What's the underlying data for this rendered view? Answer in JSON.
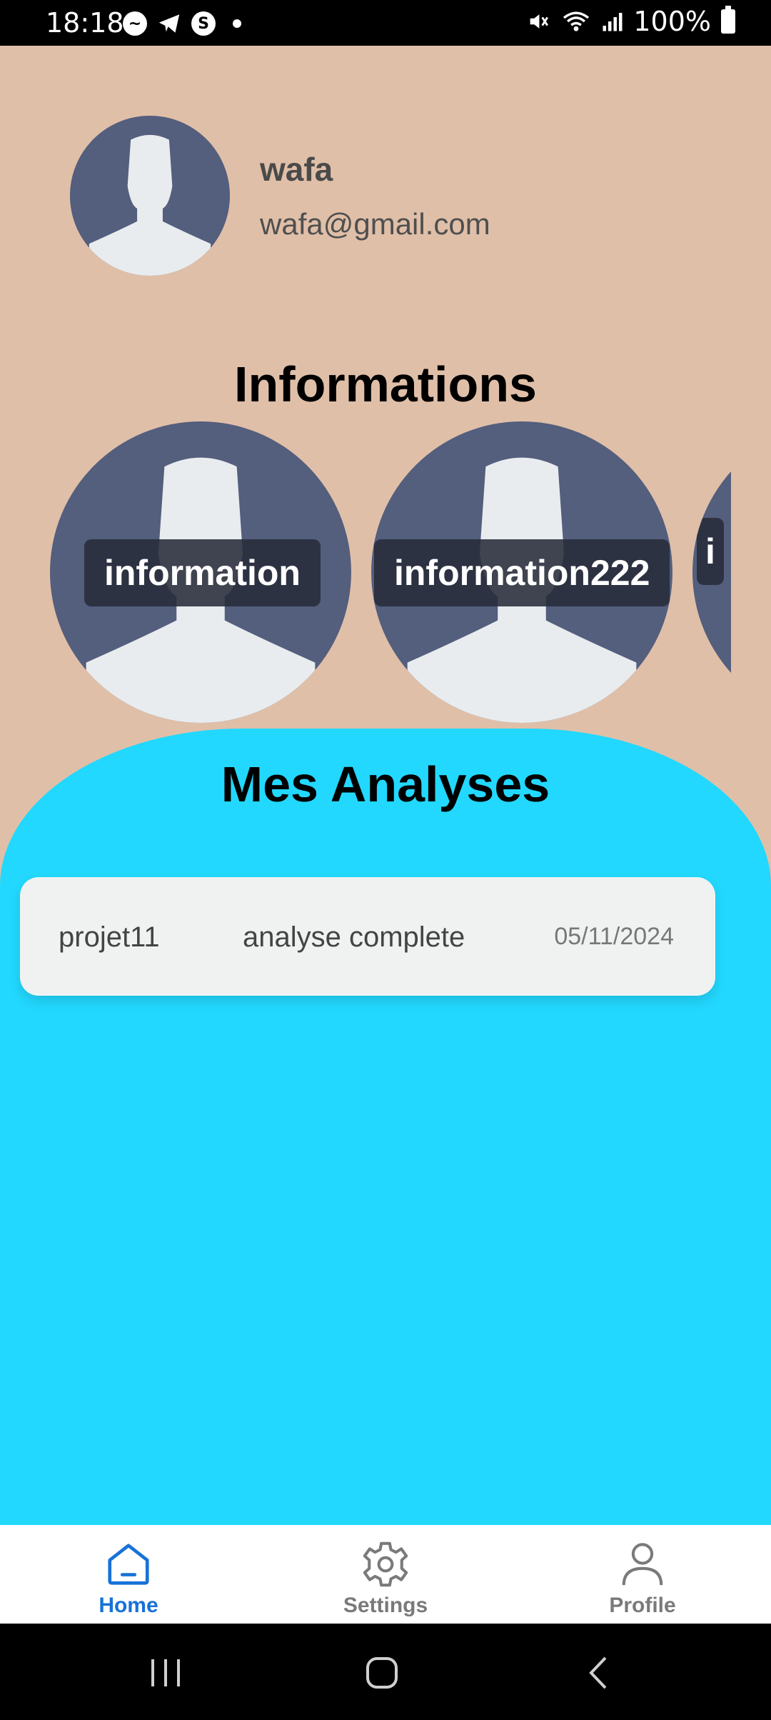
{
  "status_bar": {
    "time": "18:18",
    "battery": "100%",
    "icons": [
      "messenger-icon",
      "telegram-icon",
      "skype-icon",
      "dot-icon",
      "mute-icon",
      "wifi-icon",
      "signal-icon",
      "battery-icon"
    ]
  },
  "profile": {
    "name": "wafa",
    "email": "wafa@gmail.com"
  },
  "informations": {
    "title": "Informations",
    "items": [
      {
        "label": "information"
      },
      {
        "label": "information222"
      },
      {
        "label": "i"
      }
    ]
  },
  "analyses": {
    "title": "Mes Analyses",
    "items": [
      {
        "project": "projet11",
        "type": "analyse complete",
        "date": "05/11/2024"
      }
    ]
  },
  "bottom_nav": {
    "items": [
      {
        "label": "Home",
        "active": true
      },
      {
        "label": "Settings"
      },
      {
        "label": "Profile"
      }
    ]
  },
  "colors": {
    "background": "#e0bfa8",
    "panel": "#22d8fe",
    "accent": "#1772d8",
    "avatar": "#545e7d"
  }
}
